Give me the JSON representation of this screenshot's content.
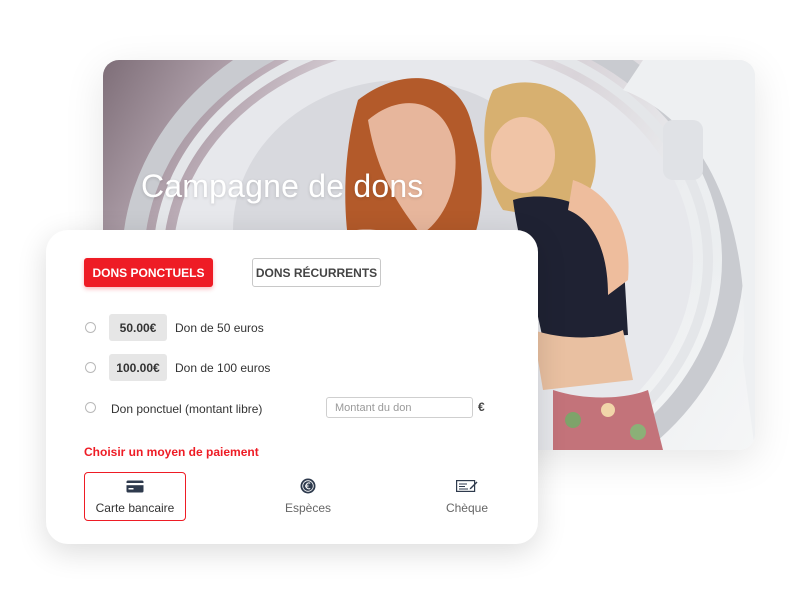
{
  "hero": {
    "title": "Campagne de dons"
  },
  "tabs": [
    {
      "label": "DONS PONCTUELS",
      "active": true
    },
    {
      "label": "DONS RÉCURRENTS",
      "active": false
    }
  ],
  "options": [
    {
      "amount": "50.00€",
      "label": "Don de 50 euros"
    },
    {
      "amount": "100.00€",
      "label": "Don de 100 euros"
    },
    {
      "label": "Don ponctuel (montant libre)",
      "placeholder": "Montant du don",
      "currency": "€"
    }
  ],
  "payment": {
    "title": "Choisir un moyen de paiement",
    "methods": [
      {
        "label": "Carte bancaire",
        "icon": "credit-card-icon",
        "selected": true
      },
      {
        "label": "Espèces",
        "icon": "euro-coin-icon",
        "selected": false
      },
      {
        "label": "Chèque",
        "icon": "cheque-icon",
        "selected": false
      }
    ]
  },
  "colors": {
    "accent": "#ee1c25",
    "icon_dark": "#2e3a4d"
  }
}
